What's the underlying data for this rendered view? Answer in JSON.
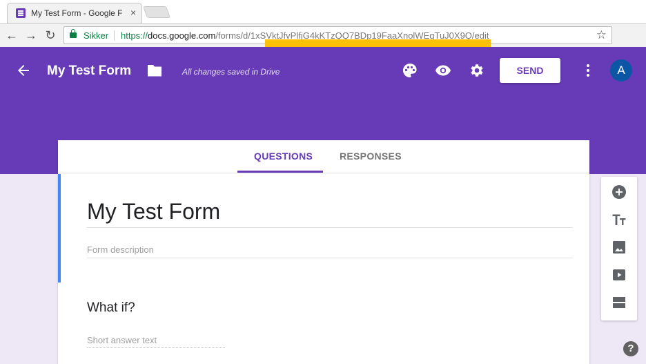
{
  "browser": {
    "tab_title": "My Test Form - Google F",
    "tab_close": "×",
    "back_glyph": "←",
    "forward_glyph": "→",
    "reload_glyph": "↻",
    "secure_label": "Sikker",
    "url_scheme": "https://",
    "url_host": "docs.google.com",
    "url_path": "/forms/d/1xSVktJfvPlfjG4kKTzQQ7BDp19FaaXnolWEqTuJ0X9Q/edit",
    "star_glyph": "☆",
    "highlight_color": "#ffc107"
  },
  "header": {
    "title": "My Test Form",
    "save_status": "All changes saved in Drive",
    "send_label": "SEND",
    "avatar_letter": "A",
    "icons": [
      "back-arrow-icon",
      "folder-icon",
      "palette-icon",
      "eye-icon",
      "gear-icon",
      "more-vert-icon"
    ],
    "color": "#673ab7"
  },
  "tabs": [
    {
      "label": "QUESTIONS",
      "active": true
    },
    {
      "label": "RESPONSES",
      "active": false
    }
  ],
  "form": {
    "title": "My Test Form",
    "description_placeholder": "Form description",
    "question_title": "What if?",
    "answer_placeholder": "Short answer text",
    "accent_color": "#4285f4"
  },
  "side_toolbar": [
    "add-question-icon",
    "add-title-icon",
    "add-image-icon",
    "add-video-icon",
    "add-section-icon"
  ],
  "help_glyph": "?"
}
